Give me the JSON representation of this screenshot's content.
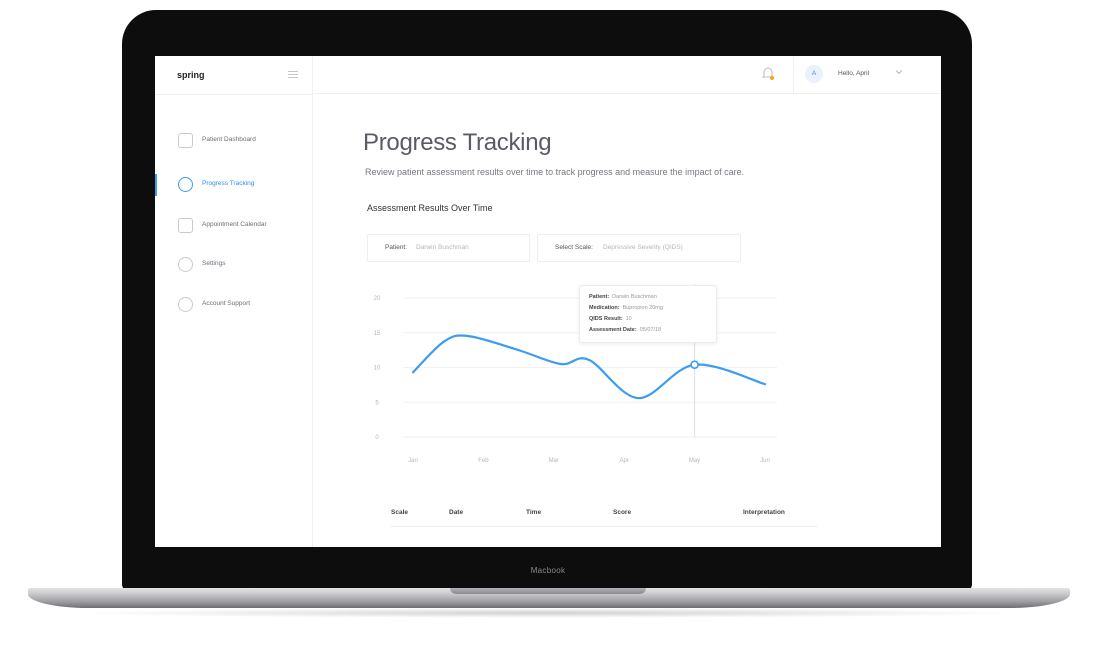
{
  "device": {
    "label": "Macbook"
  },
  "app": {
    "logo": "spring",
    "greeting": "Hello, April",
    "avatar_initial": "A",
    "accent": "#3d9bf0"
  },
  "sidebar": {
    "items": [
      {
        "label": "Patient Dashboard",
        "icon": "dashboard-icon",
        "active": false
      },
      {
        "label": "Progress Tracking",
        "icon": "progress-icon",
        "active": true
      },
      {
        "label": "Appointment Calendar",
        "icon": "calendar-icon",
        "active": false
      },
      {
        "label": "Settings",
        "icon": "gear-icon",
        "active": false
      },
      {
        "label": "Account Support",
        "icon": "support-icon",
        "active": false
      }
    ]
  },
  "main": {
    "title": "Progress Tracking",
    "subtitle": "Review patient assessment results over time to track progress and measure the impact of care.",
    "section_title": "Assessment Results Over Time",
    "filters": {
      "patient_label": "Patient:",
      "patient_value": "Darwin Buschman",
      "scale_label": "Select Scale:",
      "scale_value": "Depressive Severity (QIDS)"
    }
  },
  "tooltip": {
    "patient_label": "Patient:",
    "patient_value": "Darwin Buschman",
    "medication_label": "Medication:",
    "medication_value": "Bupropion 20mg",
    "result_label": "QIDS Result:",
    "result_value": "10",
    "date_label": "Assessment Date:",
    "date_value": "05/07/18"
  },
  "chart_data": {
    "type": "line",
    "x": [
      "Jan",
      "Feb",
      "Mar",
      "Apr",
      "May",
      "Jun"
    ],
    "yticks": [
      0,
      5,
      10,
      15,
      20
    ],
    "ylim": [
      0,
      20
    ],
    "grid": true,
    "series": [
      {
        "color": "#3d9bf0",
        "points": [
          [
            0,
            9.3
          ],
          [
            0.45,
            13.8
          ],
          [
            0.8,
            14.5
          ],
          [
            1.5,
            12.5
          ],
          [
            2.1,
            10.5
          ],
          [
            2.5,
            11.1
          ],
          [
            3.2,
            5.6
          ],
          [
            4.0,
            10.4
          ],
          [
            5.0,
            7.6
          ]
        ]
      }
    ],
    "highlight": {
      "x": "May",
      "y": 10.4
    }
  },
  "table": {
    "headers": [
      "Scale",
      "Date",
      "Time",
      "Score",
      "Interpretation"
    ]
  }
}
